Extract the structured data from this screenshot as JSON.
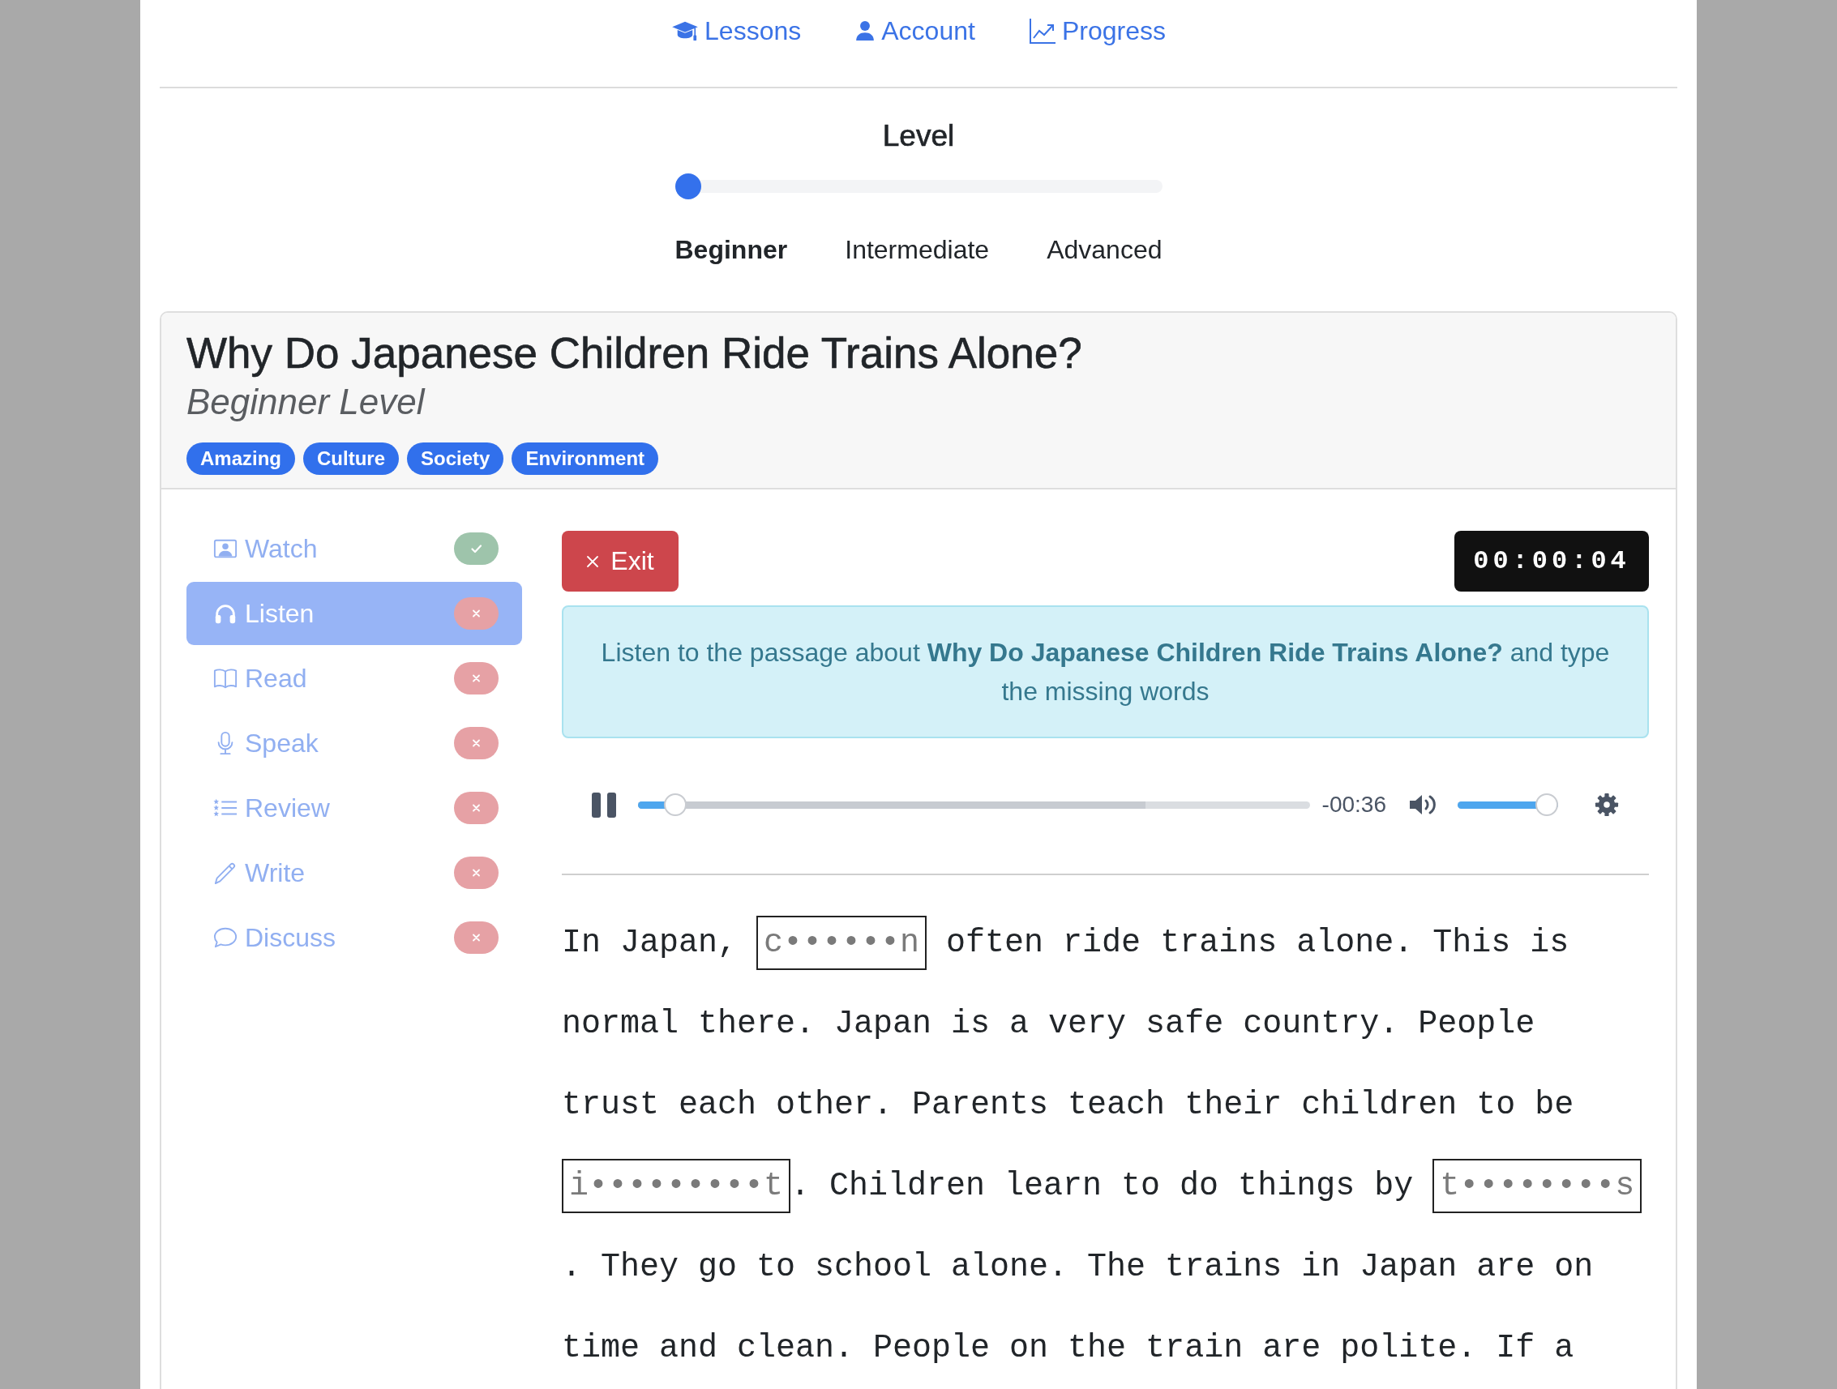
{
  "nav": [
    "Lessons",
    "Account",
    "Progress"
  ],
  "level_picker": {
    "title": "Level",
    "level": 0,
    "options": [
      {
        "label": "Beginner",
        "selected": true
      },
      {
        "label": "Intermediate",
        "selected": false
      },
      {
        "label": "Advanced",
        "selected": false
      }
    ]
  },
  "lesson": {
    "title": "Why Do Japanese Children Ride Trains Alone?",
    "subtitle": "Beginner Level",
    "tags": [
      "Amazing",
      "Culture",
      "Society",
      "Environment"
    ]
  },
  "sidebar": {
    "items": [
      {
        "label": "Watch",
        "selected": false,
        "completed": true
      },
      {
        "label": "Listen",
        "selected": true,
        "completed": false
      },
      {
        "label": "Read",
        "selected": false,
        "completed": false
      },
      {
        "label": "Speak",
        "selected": false,
        "completed": false
      },
      {
        "label": "Review",
        "selected": false,
        "completed": false
      },
      {
        "label": "Write",
        "selected": false,
        "completed": false
      },
      {
        "label": "Discuss",
        "selected": false,
        "completed": false
      }
    ]
  },
  "exercise": {
    "exit_button": "Exit",
    "timer": "00:00:04",
    "instruction": "Listen to the passage about **Why Do Japanese Children Ride Trains Alone?** and type the missing words",
    "player": {
      "playing": true,
      "progress": {
        "level": 0.04
      },
      "buffered": {
        "level": 0.755
      },
      "time_remaining": "-00:36",
      "volume": {
        "level": 1
      }
    },
    "passage": {
      "lines": [
        [
          {
            "kind": "text",
            "text": "In Japan, "
          },
          {
            "kind": "blank",
            "placeholder": "c••••••n"
          },
          {
            "kind": "text",
            "text": " often ride trains alone. This is"
          }
        ],
        [
          {
            "kind": "text",
            "text": "normal there. Japan is a very safe country. People"
          }
        ],
        [
          {
            "kind": "text",
            "text": "trust each other. Parents teach their children to be"
          }
        ],
        [
          {
            "kind": "blank",
            "placeholder": "i•••••••••t"
          },
          {
            "kind": "text",
            "text": ". Children learn to do things by "
          },
          {
            "kind": "blank",
            "placeholder": "t••••••••s"
          }
        ],
        [
          {
            "kind": "text",
            "text": ". They go to school alone. The trains in Japan are on"
          }
        ],
        [
          {
            "kind": "text",
            "text": "time and clean. People on the train are polite. If a"
          }
        ]
      ]
    }
  }
}
